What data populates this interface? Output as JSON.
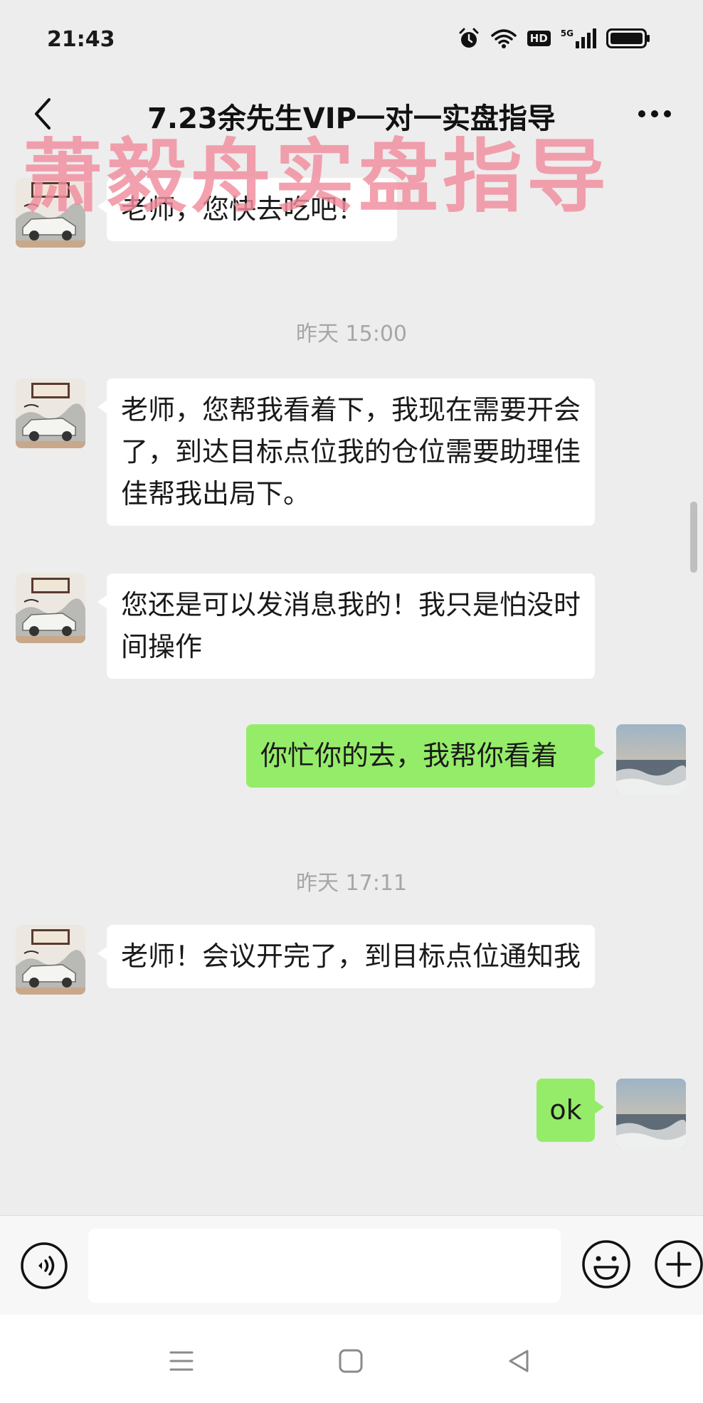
{
  "status_bar": {
    "time": "21:43",
    "hd_label": "HD",
    "network_label": "5G"
  },
  "chat": {
    "title": "7.23余先生VIP一对一实盘指导",
    "watermark": "萧毅舟实盘指导"
  },
  "messages": [
    {
      "type": "incoming",
      "text": "老师，您快去吃吧！"
    },
    {
      "type": "timestamp",
      "text": "昨天 15:00"
    },
    {
      "type": "incoming",
      "text": "老师，您帮我看着下，我现在需要开会了，到达目标点位我的仓位需要助理佳佳帮我出局下。"
    },
    {
      "type": "incoming",
      "text": "您还是可以发消息我的！我只是怕没时间操作"
    },
    {
      "type": "outgoing",
      "text": "你忙你的去，我帮你看着"
    },
    {
      "type": "timestamp",
      "text": "昨天 17:11"
    },
    {
      "type": "incoming",
      "text": "老师！会议开完了，到目标点位通知我"
    },
    {
      "type": "outgoing",
      "text": "ok"
    }
  ],
  "input": {
    "value": ""
  },
  "icons": {
    "back": "chevron-left-icon",
    "more": "more-dots-icon",
    "voice": "voice-icon",
    "emoji": "emoji-icon",
    "plus": "plus-icon",
    "sys_menu": "menu-icon",
    "sys_home": "home-icon",
    "sys_back": "back-triangle-icon"
  },
  "colors": {
    "background": "#ededed",
    "incoming_bubble": "#ffffff",
    "outgoing_bubble": "#95ec69",
    "watermark": "#f08c9e",
    "timestamp": "#a6a6a6"
  }
}
